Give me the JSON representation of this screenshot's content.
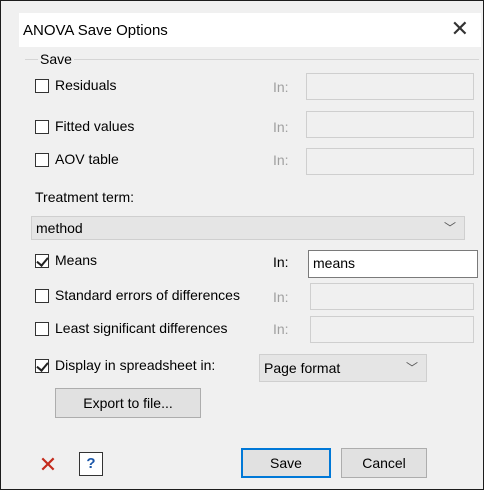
{
  "window": {
    "title": "ANOVA Save Options",
    "close_glyph": "✕"
  },
  "save_group": {
    "label": "Save",
    "residuals": {
      "label": "Residuals",
      "checked": false,
      "in_label": "In:",
      "value": ""
    },
    "fitted_values": {
      "label": "Fitted values",
      "checked": false,
      "in_label": "In:",
      "value": ""
    },
    "aov_table": {
      "label": "AOV table",
      "checked": false,
      "in_label": "In:",
      "value": ""
    }
  },
  "treatment": {
    "label": "Treatment term:",
    "selected": "method",
    "chevron": "﹀"
  },
  "means": {
    "label": "Means",
    "checked": true,
    "in_label": "In:",
    "value": "means"
  },
  "sed": {
    "label": "Standard errors of differences",
    "checked": false,
    "in_label": "In:",
    "value": ""
  },
  "lsd": {
    "label": "Least significant differences",
    "checked": false,
    "in_label": "In:",
    "value": ""
  },
  "display": {
    "label": "Display in spreadsheet in:",
    "checked": true,
    "selected": "Page format",
    "chevron": "﹀"
  },
  "buttons": {
    "export": "Export to file...",
    "save": "Save",
    "cancel": "Cancel",
    "clear_icon_glyph": "✕",
    "help_icon_glyph": "?"
  },
  "colors": {
    "clear_icon": "#c42b1c",
    "help_icon": "#1a56a8",
    "default_button_border": "#0078d7"
  }
}
